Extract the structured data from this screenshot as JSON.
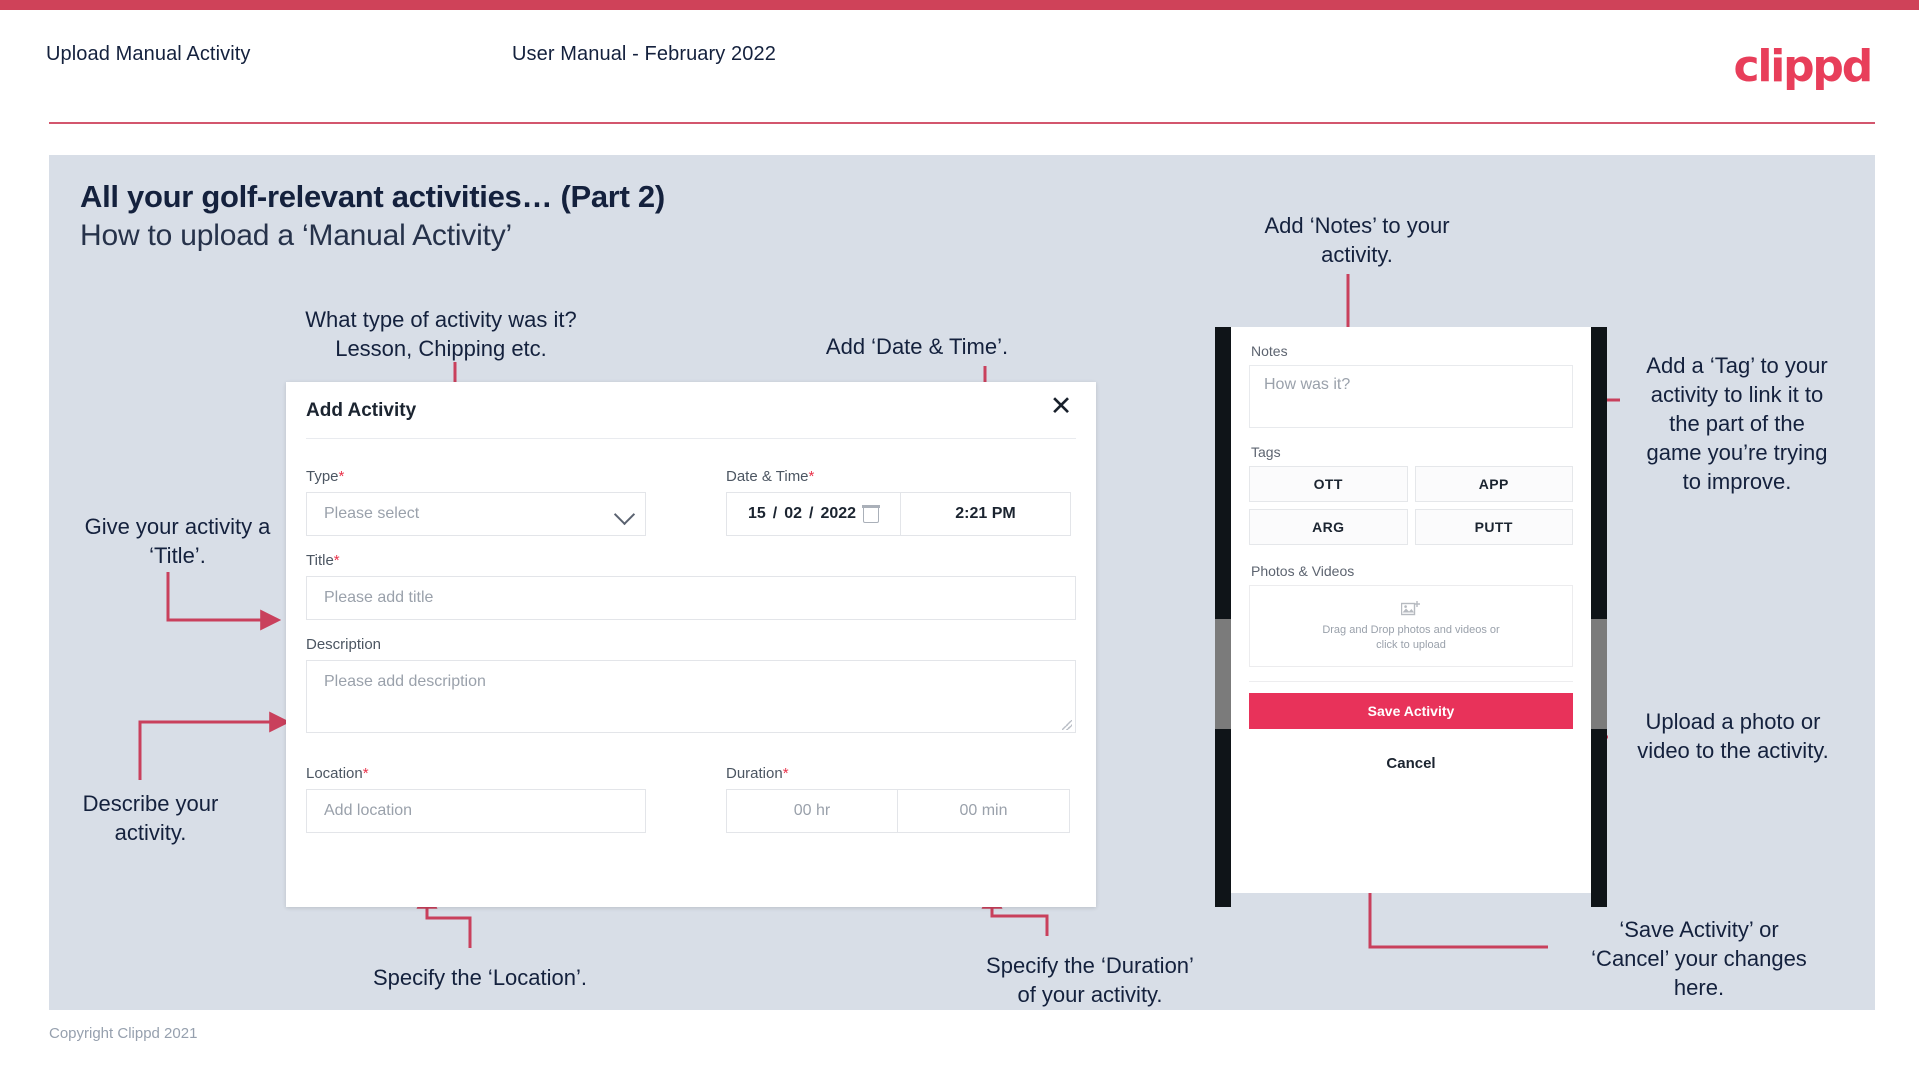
{
  "header": {
    "title": "Upload Manual Activity",
    "subtitle": "User Manual - February 2022",
    "logo": "clippd"
  },
  "slide": {
    "title": "All your golf-relevant activities… (Part 2)",
    "subtitle": "How to upload a ‘Manual Activity’",
    "copyright": "Copyright Clippd 2021"
  },
  "dialog": {
    "title": "Add Activity",
    "close_icon": "close-icon",
    "type": {
      "label": "Type",
      "required": "*",
      "placeholder": "Please select"
    },
    "datetime": {
      "label": "Date & Time",
      "required": "*",
      "day": "15",
      "sep1": "/",
      "month": "02",
      "sep2": "/",
      "year": "2022",
      "time": "2:21 PM"
    },
    "title_field": {
      "label": "Title",
      "required": "*",
      "placeholder": "Please add title"
    },
    "description": {
      "label": "Description",
      "placeholder": "Please add description"
    },
    "location": {
      "label": "Location",
      "required": "*",
      "placeholder": "Add location"
    },
    "duration": {
      "label": "Duration",
      "required": "*",
      "hours": "00 hr",
      "minutes": "00 min"
    }
  },
  "phone": {
    "notes": {
      "label": "Notes",
      "placeholder": "How was it?"
    },
    "tags": {
      "label": "Tags",
      "items": [
        "OTT",
        "APP",
        "ARG",
        "PUTT"
      ]
    },
    "photos": {
      "label": "Photos & Videos",
      "icon": "add-image-icon",
      "line1": "Drag and Drop photos and videos or",
      "line2": "click to upload"
    },
    "save_label": "Save Activity",
    "cancel_label": "Cancel"
  },
  "annotations": {
    "type": "What type of activity was it?\nLesson, Chipping etc.",
    "datetime": "Add ‘Date & Time’.",
    "title": "Give your activity a\n‘Title’.",
    "description": "Describe your\nactivity.",
    "location": "Specify the ‘Location’.",
    "duration": "Specify the ‘Duration’\nof your activity.",
    "notes": "Add ‘Notes’ to your\nactivity.",
    "tags": "Add a ‘Tag’ to your\nactivity to link it to\nthe part of the\ngame you’re trying\nto improve.",
    "photos": "Upload a photo or\nvideo to the activity.",
    "save": "‘Save Activity’ or\n‘Cancel’ your changes\nhere."
  },
  "colors": {
    "accent": "#e8325a",
    "top_bar": "#cf4259",
    "slide_bg": "#d8dee7",
    "arrow": "#c9405c",
    "text_dark": "#14213d"
  }
}
